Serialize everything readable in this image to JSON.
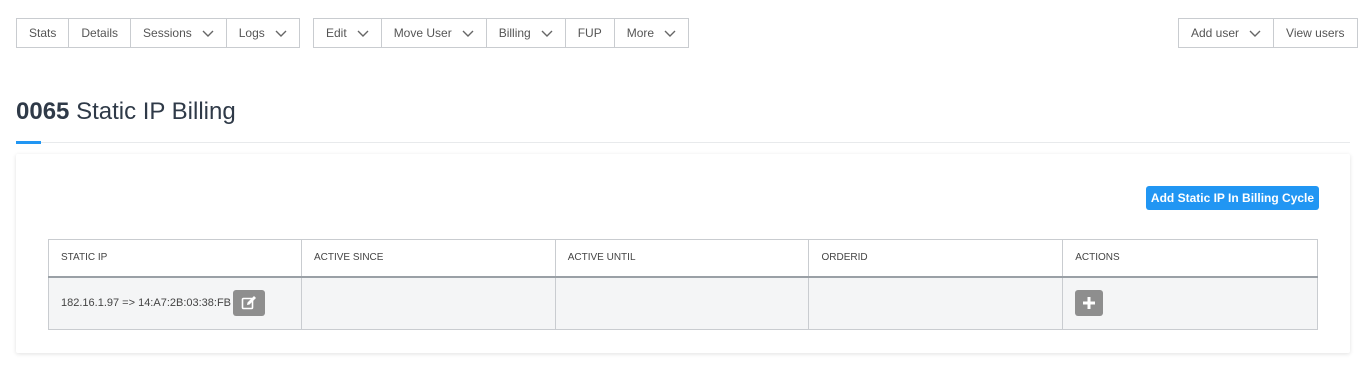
{
  "toolbar_left": {
    "stats": "Stats",
    "details": "Details",
    "sessions": "Sessions",
    "logs": "Logs"
  },
  "toolbar_mid": {
    "edit": "Edit",
    "move_user": "Move User",
    "billing": "Billing",
    "fup": "FUP",
    "more": "More"
  },
  "toolbar_right": {
    "add_user": "Add user",
    "view_users": "View users"
  },
  "page": {
    "title_number": "0065",
    "title_text": "Static IP Billing"
  },
  "actions": {
    "add_static_ip": "Add Static IP In Billing Cycle"
  },
  "table": {
    "headers": [
      "STATIC IP",
      "ACTIVE SINCE",
      "ACTIVE UNTIL",
      "ORDERID",
      "ACTIONS"
    ],
    "rows": [
      {
        "static_ip": "182.16.1.97 => 14:A7:2B:03:38:FB",
        "active_since": "",
        "active_until": "",
        "orderid": ""
      }
    ]
  },
  "colors": {
    "accent": "#2196f3",
    "icon_button": "#8e8e8e"
  },
  "icons": [
    "chevron-down-icon",
    "edit-icon",
    "plus-icon"
  ]
}
